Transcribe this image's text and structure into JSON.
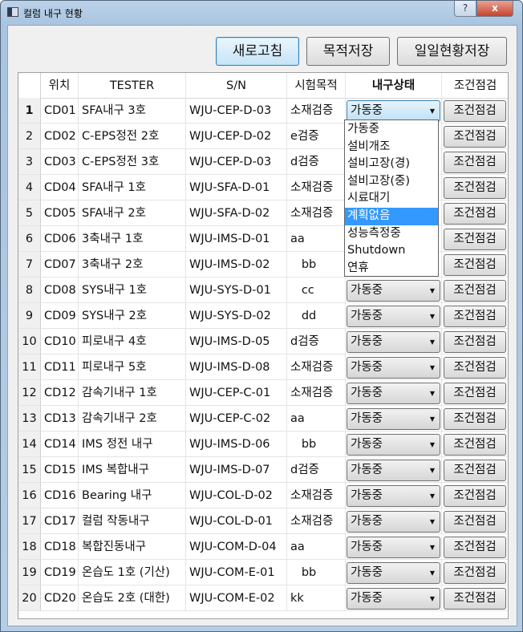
{
  "window": {
    "title": "컬럼 내구 현황",
    "help": "?",
    "close": "x"
  },
  "toolbar": {
    "refresh": "새로고침",
    "save_purpose": "목적저장",
    "save_daily": "일일현황저장"
  },
  "table": {
    "headers": [
      "위치",
      "TESTER",
      "S/N",
      "시험목적",
      "내구상태",
      "조건점검"
    ],
    "check_label": "조건점검",
    "rows": [
      {
        "n": "1",
        "loc": "CD01",
        "tester": "SFA내구 3호",
        "sn": "WJU-CEP-D-03",
        "purpose": "소재검증",
        "status": "가동중"
      },
      {
        "n": "2",
        "loc": "CD02",
        "tester": "C-EPS정전 2호",
        "sn": "WJU-CEP-D-02",
        "purpose": "e검증",
        "status": ""
      },
      {
        "n": "3",
        "loc": "CD03",
        "tester": "C-EPS정전 3호",
        "sn": "WJU-CEP-D-03",
        "purpose": "d검증",
        "status": ""
      },
      {
        "n": "4",
        "loc": "CD04",
        "tester": "SFA내구 1호",
        "sn": "WJU-SFA-D-01",
        "purpose": "소재검증",
        "status": ""
      },
      {
        "n": "5",
        "loc": "CD05",
        "tester": "SFA내구 2호",
        "sn": "WJU-SFA-D-02",
        "purpose": "소재검증",
        "status": ""
      },
      {
        "n": "6",
        "loc": "CD06",
        "tester": "3축내구 1호",
        "sn": "WJU-IMS-D-01",
        "purpose": "aa",
        "status": ""
      },
      {
        "n": "7",
        "loc": "CD07",
        "tester": "3축내구 2호",
        "sn": "WJU-IMS-D-02",
        "purpose": "   bb",
        "status": ""
      },
      {
        "n": "8",
        "loc": "CD08",
        "tester": "SYS내구 1호",
        "sn": "WJU-SYS-D-01",
        "purpose": "   cc",
        "status": "가동중"
      },
      {
        "n": "9",
        "loc": "CD09",
        "tester": "SYS내구 2호",
        "sn": "WJU-SYS-D-02",
        "purpose": "   dd",
        "status": "가동중"
      },
      {
        "n": "10",
        "loc": "CD10",
        "tester": "피로내구 4호",
        "sn": "WJU-IMS-D-05",
        "purpose": "d검증",
        "status": "가동중"
      },
      {
        "n": "11",
        "loc": "CD11",
        "tester": "피로내구 5호",
        "sn": "WJU-IMS-D-08",
        "purpose": "소재검증",
        "status": "가동중"
      },
      {
        "n": "12",
        "loc": "CD12",
        "tester": "감속기내구 1호",
        "sn": "WJU-CEP-C-01",
        "purpose": "소재검증",
        "status": "가동중"
      },
      {
        "n": "13",
        "loc": "CD13",
        "tester": "감속기내구 2호",
        "sn": "WJU-CEP-C-02",
        "purpose": "aa",
        "status": "가동중"
      },
      {
        "n": "14",
        "loc": "CD14",
        "tester": "IMS 정전 내구",
        "sn": "WJU-IMS-D-06",
        "purpose": "   bb",
        "status": "가동중"
      },
      {
        "n": "15",
        "loc": "CD15",
        "tester": "IMS 복합내구",
        "sn": "WJU-IMS-D-07",
        "purpose": "d검증",
        "status": "가동중"
      },
      {
        "n": "16",
        "loc": "CD16",
        "tester": "Bearing 내구",
        "sn": "WJU-COL-D-02",
        "purpose": "소재검증",
        "status": "가동중"
      },
      {
        "n": "17",
        "loc": "CD17",
        "tester": "컬럼 작동내구",
        "sn": "WJU-COL-D-01",
        "purpose": "소재검증",
        "status": "가동중"
      },
      {
        "n": "18",
        "loc": "CD18",
        "tester": "복합진동내구",
        "sn": "WJU-COM-D-04",
        "purpose": "aa",
        "status": "가동중"
      },
      {
        "n": "19",
        "loc": "CD19",
        "tester": "온습도 1호 (기산)",
        "sn": "WJU-COM-E-01",
        "purpose": "   bb",
        "status": "가동중"
      },
      {
        "n": "20",
        "loc": "CD20",
        "tester": "온습도 2호 (대한)",
        "sn": "WJU-COM-E-02",
        "purpose": "kk",
        "status": "가동중"
      }
    ]
  },
  "dropdown": {
    "options": [
      "가동중",
      "설비개조",
      "설비고장(경)",
      "설비고장(중)",
      "시료대기",
      "계획없음",
      "성능측정중",
      "Shutdown",
      "연휴"
    ],
    "highlighted": "계획없음"
  },
  "colors": {
    "highlight": "#3399ff",
    "focus_border": "#3c7fb1"
  }
}
